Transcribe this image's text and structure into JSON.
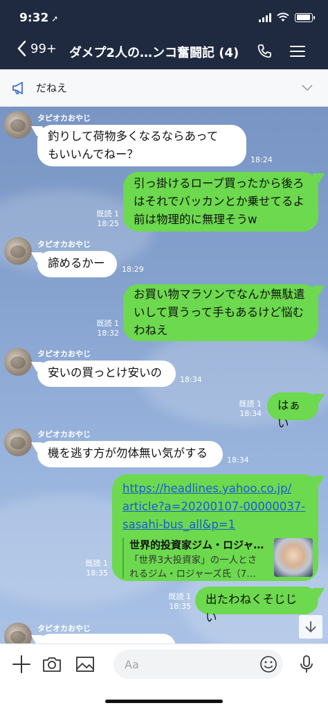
{
  "status_bar": {
    "time": "9:32",
    "location_arrow": "location-arrow-icon"
  },
  "header": {
    "back_count": "99+",
    "title": "ダメプ2人の…ンコ奮闘記 (4)",
    "icons": [
      "phone-icon",
      "menu-icon"
    ]
  },
  "announcement": {
    "text": "だねえ"
  },
  "messages": [
    {
      "dir": "in",
      "sender": "タピオカおやじ",
      "lines": [
        "釣りして荷物多くなるならあって",
        "もいいんでねー？"
      ],
      "time": "18:24"
    },
    {
      "dir": "out",
      "read": "既読 1",
      "lines": [
        "引っ掛けるロープ買ったから後ろ",
        "はそれでバッカンとか乗せてるよ",
        "前は物理的に無理そうw"
      ],
      "time": "18:25"
    },
    {
      "dir": "in",
      "sender": "タピオカおやじ",
      "lines": [
        "諦めるかー"
      ],
      "time": "18:29"
    },
    {
      "dir": "out",
      "read": "既読 1",
      "lines": [
        "お買い物マラソンでなんか無駄遣",
        "いして買うって手もあるけど悩む",
        "わねえ"
      ],
      "time": "18:32"
    },
    {
      "dir": "in",
      "sender": "タピオカおやじ",
      "lines": [
        "安いの買っとけ安いの"
      ],
      "time": "18:34"
    },
    {
      "dir": "out",
      "read": "既読 1",
      "lines": [
        "はぁい"
      ],
      "time": "18:34"
    },
    {
      "dir": "in",
      "sender": "タピオカおやじ",
      "lines": [
        "機を逃す方が勿体無い気がする"
      ],
      "time": "18:34"
    },
    {
      "dir": "out",
      "read": "既読 1",
      "time": "18:35",
      "link_lines": [
        "https://headlines.yahoo.co.jp/",
        "article?a=20200107-00000037-",
        "sasahi-bus_all&p=1"
      ],
      "preview_title": "世界的投資家ジム・ロジャ…",
      "preview_desc": [
        "「世界3大投資家」の一人とさ",
        "れるジム・ロジャーズ氏（7…"
      ]
    },
    {
      "dir": "out",
      "read": "既読 1",
      "lines": [
        "出たわねくそじじい"
      ],
      "time": "18:35"
    },
    {
      "dir": "in",
      "sender": "タピオカおやじ",
      "lines": [
        ""
      ]
    }
  ],
  "input": {
    "placeholder": "Aa"
  },
  "colors": {
    "header_bg": "#1f2a40",
    "outgoing_bubble": "#6cd94e",
    "incoming_bubble": "#ffffff",
    "link": "#1a5bd6"
  }
}
